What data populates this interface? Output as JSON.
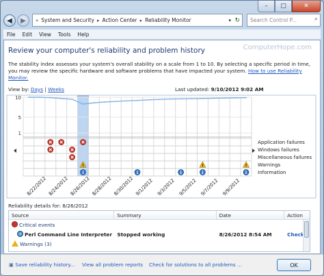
{
  "window": {
    "minimize": "–",
    "maximize": "□",
    "close": "✕"
  },
  "address": {
    "crumbs": [
      "System and Security",
      "Action Center",
      "Reliability Monitor"
    ],
    "search_placeholder": "Search Control P..."
  },
  "menu": [
    "File",
    "Edit",
    "View",
    "Tools",
    "Help"
  ],
  "page": {
    "title": "Review your computer's reliability and problem history",
    "watermark": "ComputerHope.com",
    "description": "The stability index assesses your system's overall stability on a scale from 1 to 10. By selecting a specific period in time, you may review the specific hardware and software problems that have impacted your system.",
    "howto_link": "How to use Reliability Monitor.",
    "view_by_label": "View by:",
    "view_days": "Days",
    "view_weeks": "Weeks",
    "last_updated_label": "Last updated:",
    "last_updated_value": "9/10/2012 9:02 AM"
  },
  "chart_data": {
    "type": "line",
    "y_ticks": [
      "10",
      "5",
      "1"
    ],
    "ylim": [
      0,
      10
    ],
    "x": [
      "8/21",
      "8/22",
      "8/23",
      "8/24",
      "8/25",
      "8/26",
      "8/27",
      "8/28",
      "8/29",
      "8/30",
      "8/31",
      "9/1",
      "9/2",
      "9/3",
      "9/4",
      "9/5",
      "9/6",
      "9/7",
      "9/8",
      "9/9",
      "9/10"
    ],
    "date_labels": [
      "8/22/2012",
      "8/24/2012",
      "8/26/2012",
      "8/28/2012",
      "8/30/2012",
      "9/1/2012",
      "9/3/2012",
      "9/5/2012",
      "9/7/2012",
      "9/9/2012"
    ],
    "stability_index": [
      10,
      10,
      9.9,
      9.7,
      9.5,
      8.3,
      8.6,
      8.8,
      8.95,
      9.1,
      9.2,
      9.35,
      9.45,
      9.55,
      9.6,
      9.65,
      9.7,
      9.75,
      9.8,
      9.85,
      9.9
    ],
    "selected_index": 5,
    "rows": [
      "Application failures",
      "Windows failures",
      "Miscellaneous failures",
      "Warnings",
      "Information"
    ],
    "markers": [
      {
        "i": 2,
        "row": 0,
        "kind": "error"
      },
      {
        "i": 3,
        "row": 0,
        "kind": "error"
      },
      {
        "i": 5,
        "row": 0,
        "kind": "error"
      },
      {
        "i": 2,
        "row": 1,
        "kind": "error"
      },
      {
        "i": 4,
        "row": 1,
        "kind": "error"
      },
      {
        "i": 4,
        "row": 2,
        "kind": "error"
      },
      {
        "i": 5,
        "row": 3,
        "kind": "warning"
      },
      {
        "i": 16,
        "row": 3,
        "kind": "warning"
      },
      {
        "i": 20,
        "row": 3,
        "kind": "warning"
      },
      {
        "i": 5,
        "row": 4,
        "kind": "info"
      },
      {
        "i": 10,
        "row": 4,
        "kind": "info"
      },
      {
        "i": 14,
        "row": 4,
        "kind": "info"
      },
      {
        "i": 16,
        "row": 4,
        "kind": "info"
      },
      {
        "i": 20,
        "row": 4,
        "kind": "info"
      }
    ]
  },
  "details": {
    "label": "Reliability details for: 8/26/2012",
    "columns": [
      "Source",
      "Summary",
      "Date",
      "Action"
    ],
    "critical_group": "Critical events",
    "row": {
      "source": "Perl Command Line Interpreter",
      "summary": "Stopped working",
      "date": "8/26/2012 8:54 AM",
      "action": "Check f"
    },
    "warnings_group": "Warnings (3)"
  },
  "footer": {
    "save": "Save reliability history...",
    "view_all": "View all problem reports",
    "check": "Check for solutions to all problems ...",
    "ok": "OK"
  },
  "colors": {
    "accent": "#1c55c0",
    "title": "#1d3b72",
    "selected": "#bcd5f2",
    "line": "#7fb2e0"
  }
}
